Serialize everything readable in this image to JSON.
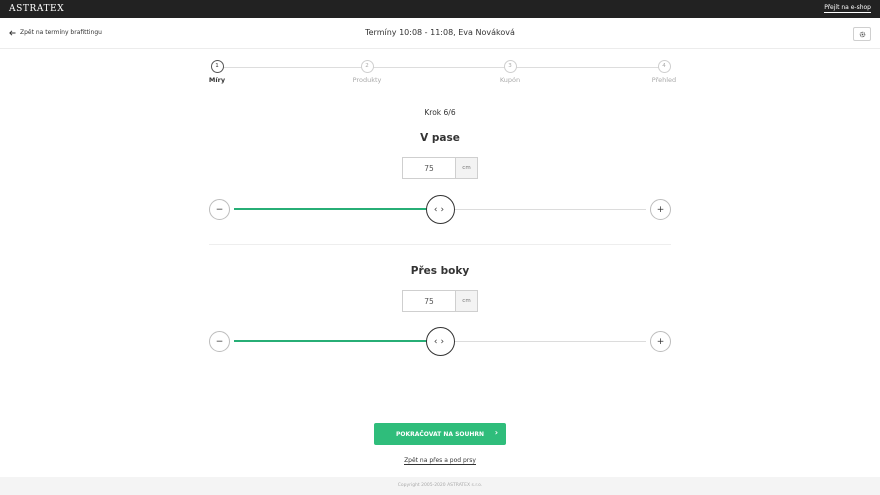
{
  "topbar": {
    "logo": "ASTRATEX",
    "eshop_link": "Přejít na e-shop"
  },
  "header": {
    "back_link": "Zpět na termíny brafittingu",
    "title": "Termíny 10:08 - 11:08, Eva Nováková",
    "settings_icon": "gear-icon"
  },
  "stepper": {
    "active_step": 1,
    "steps": [
      {
        "number": "1",
        "label": "Míry"
      },
      {
        "number": "2",
        "label": "Produkty"
      },
      {
        "number": "3",
        "label": "Kupón"
      },
      {
        "number": "4",
        "label": "Přehled"
      }
    ]
  },
  "step_count": "Krok 6/6",
  "measures": [
    {
      "title": "V pase",
      "value": "75",
      "unit": "cm",
      "minus_label": "−",
      "plus_label": "+",
      "slider_level": 0.5
    },
    {
      "title": "Přes boky",
      "value": "75",
      "unit": "cm",
      "minus_label": "−",
      "plus_label": "+",
      "slider_level": 0.5
    }
  ],
  "actions": {
    "continue_label": "POKRAČOVAT NA SOUHRN",
    "continue_chevron": "›",
    "back_step_label": "Zpět na přes a pod prsy"
  },
  "footer": {
    "copyright": "Copyright 2005-2020 ASTRATEX s.r.o."
  },
  "colors": {
    "accent": "#2fbd7b",
    "slider_fill": "#27ae76",
    "topbar": "#222222"
  }
}
